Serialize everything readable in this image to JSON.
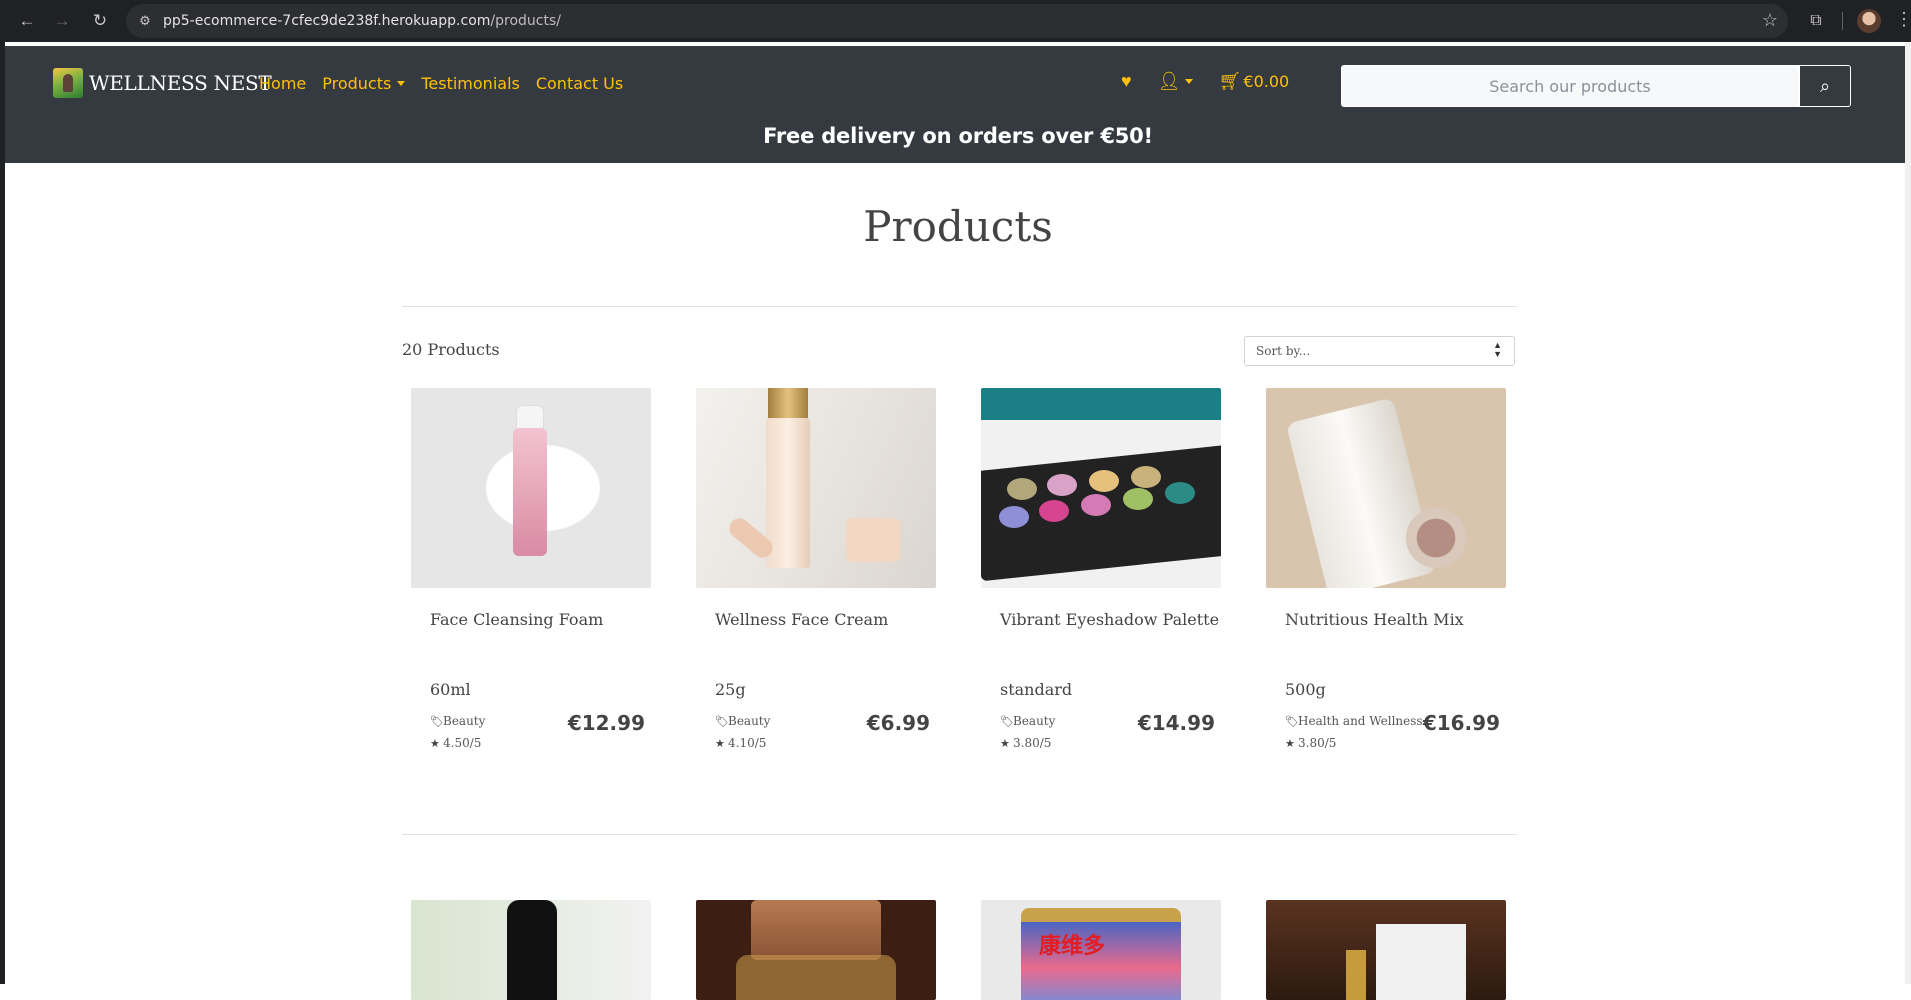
{
  "browser": {
    "url_host": "pp5-ecommerce-7cfec9de238f.herokuapp.com",
    "url_path": "/products/"
  },
  "site": {
    "brand": "WELLNESS NEST",
    "nav": [
      "Home",
      "Products",
      "Testimonials",
      "Contact Us"
    ],
    "cart_total": "€0.00",
    "search_placeholder": "Search our products",
    "banner": "Free delivery on orders over €50!"
  },
  "page": {
    "title": "Products",
    "count": "20 Products",
    "sort_label": "Sort by..."
  },
  "products": [
    {
      "name": "Face Cleansing Foam",
      "size": "60ml",
      "category": "Beauty",
      "rating": "4.50/5",
      "price": "€12.99"
    },
    {
      "name": "Wellness Face Cream",
      "size": "25g",
      "category": "Beauty",
      "rating": "4.10/5",
      "price": "€6.99"
    },
    {
      "name": "Vibrant Eyeshadow Palette",
      "size": "standard",
      "category": "Beauty",
      "rating": "3.80/5",
      "price": "€14.99"
    },
    {
      "name": "Nutritious Health Mix",
      "size": "500g",
      "category": "Health and Wellness",
      "rating": "3.80/5",
      "price": "€16.99"
    }
  ],
  "image_text": {
    "can_label": "康维多"
  },
  "colors": {
    "header_bg": "#343a40",
    "accent": "#ffc107"
  }
}
